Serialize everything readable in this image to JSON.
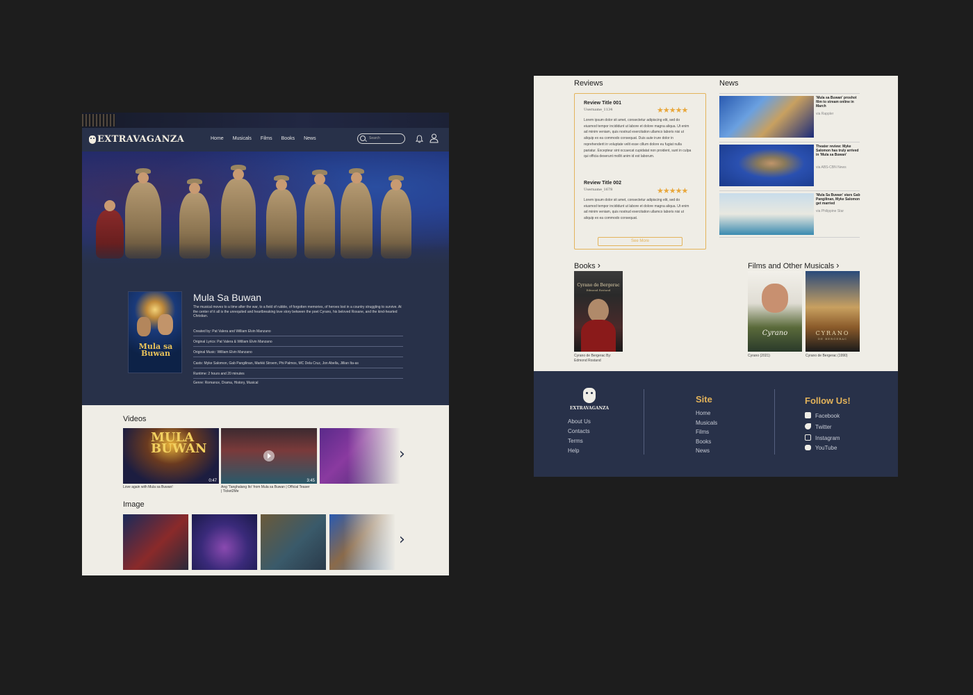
{
  "brand": {
    "name": "EXTRAVAGANZA"
  },
  "nav": {
    "links": [
      "Home",
      "Musicals",
      "Films",
      "Books",
      "News"
    ],
    "search_placeholder": "Search"
  },
  "musical": {
    "title": "Mula Sa Buwan",
    "description": "The musical moves to a time after the war, to a field of rubble, of forgotten memories, of heroes lost in a country struggling to survive. At the center of it all is the unrequited and heartbreaking love story between the poet Cyrano, his beloved Roxane, and the kind-hearted Christian.",
    "poster_title": "Mula sa Buwan",
    "created_by": "Created by: Pat Valera and William Elvin Manzano",
    "lyrics": "Original Lyrics: Pat Valera & William Elvin Manzano",
    "music": "Original Music: William Elvin Manzano",
    "cast": "Casts: Myke Salomon, Gab Pangilinan, Markki Stroem, Phi Palmos, MC Dela Cruz, Jon Abella, Jillian Ita-as",
    "runtime": "Runtime: 2 hours and 20 minutes",
    "genre": "Genre: Romance, Drama, History, Musical"
  },
  "videos": {
    "heading": "Videos",
    "items": [
      {
        "caption": "Love again with Mula sa Buwan!",
        "duration": "0:47"
      },
      {
        "caption": "Ang 'Tanghalang Ito' from Mula sa Buwan | Official Teaser | Ticket2Me",
        "duration": "3:45"
      },
      {
        "caption": "",
        "duration": ""
      }
    ]
  },
  "images": {
    "heading": "Image"
  },
  "reviews": {
    "heading": "Reviews",
    "items": [
      {
        "title": "Review Title 001",
        "user": "Username_1134",
        "stars": "★★★★★",
        "text": "Lorem ipsum dolor sit amet, consectetur adipiscing elit, sed do eiusmod tempor incididunt ut labore et dolore magna aliqua. Ut enim ad minim veniam, quis nostrud exercitation ullamco laboris nisi ut aliquip ex ea commodo consequat. Duis aute irure dolor in reprehenderit in voluptate velit esse cillum dolore eu fugiat nulla pariatur. Excepteur sint occaecat cupidatat non proident, sunt in culpa qui officia deserunt mollit anim id est laborum."
      },
      {
        "title": "Review Title 002",
        "user": "Username_1678",
        "stars": "★★★★★",
        "text": "Lorem ipsum dolor sit amet, consectetur adipiscing elit, sed do eiusmod tempor incididunt ut labore et dolore magna aliqua. Ut enim ad minim veniam, quis nostrud exercitation ullamco laboris nisi ut aliquip ex ea commodo consequat."
      }
    ],
    "see_more": "See More"
  },
  "news": {
    "heading": "News",
    "items": [
      {
        "title": "'Mula sa Buwan' proshot film to stream online in March",
        "source": "via Rappler"
      },
      {
        "title": "Theater review: Myke Salomon has truly arrived in 'Mula sa Buwan'",
        "source": "via ABS-CBN News"
      },
      {
        "title": "'Mula Sa Buwan' stars Gab Pangilinan, Myke Salomon get married",
        "source": "via Philippine Star"
      }
    ]
  },
  "books": {
    "heading": "Books",
    "items": [
      {
        "caption": "Cyrano de Bergerac By: Edmond Rostand",
        "cover_title": "Cyrano de Bergerac",
        "cover_author": "Edmond Rostand"
      }
    ]
  },
  "films": {
    "heading": "Films and Other Musicals",
    "items": [
      {
        "caption": "Cyrano (2021)",
        "cover_title": "Cyrano"
      },
      {
        "caption": "Cyrano de Bergerac (1990)",
        "cover_title": "CYRANO",
        "cover_subtitle": "DE BERGERAC"
      }
    ]
  },
  "footer": {
    "brand": "EXTRAVAGANZA",
    "about_links": [
      "About Us",
      "Contacts",
      "Terms",
      "Help"
    ],
    "site_heading": "Site",
    "site_links": [
      "Home",
      "Musicals",
      "Films",
      "Books",
      "News"
    ],
    "follow_heading": "Follow Us!",
    "social": [
      {
        "name": "Facebook",
        "icon": "facebook-icon"
      },
      {
        "name": "Twitter",
        "icon": "twitter-icon"
      },
      {
        "name": "Instagram",
        "icon": "instagram-icon"
      },
      {
        "name": "YouTube",
        "icon": "youtube-icon"
      }
    ]
  },
  "colors": {
    "navy": "#283149",
    "cream": "#efede6",
    "gold": "#e3b35a",
    "canvas": "#1d1d1d"
  }
}
